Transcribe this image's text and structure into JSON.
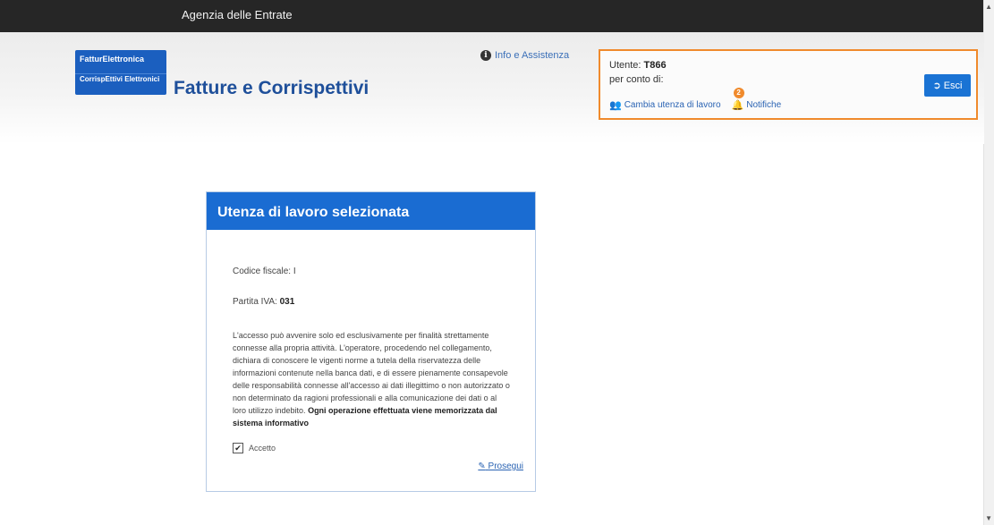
{
  "topbar": {
    "title": "Agenzia delle Entrate"
  },
  "logo": {
    "line1": "FatturElettronica",
    "line2": "CorrispEttivi Elettronici"
  },
  "app": {
    "title": "Fatture e Corrispettivi"
  },
  "info": {
    "label": "Info e Assistenza",
    "icon": "info-circle-icon"
  },
  "user_panel": {
    "user_prefix": "Utente:",
    "user_id": "T866",
    "on_behalf": "per conto di:",
    "change_label": "Cambia utenza di lavoro",
    "notifications_label": "Notifiche",
    "notifications_count": "2",
    "logout_label": "Esci",
    "border_color": "#f08a2c",
    "button_color": "#1a73d4"
  },
  "card": {
    "title": "Utenza di lavoro selezionata",
    "cf_label": "Codice fiscale:",
    "cf_value": "I",
    "piva_label": "Partita IVA:",
    "piva_value": "031",
    "legal_text": "L'accesso può avvenire solo ed esclusivamente per finalità strettamente connesse alla propria attività. L'operatore, procedendo nel collegamento, dichiara di conoscere le vigenti norme a tutela della riservatezza delle informazioni contenute nella banca dati, e di essere pienamente consapevole delle responsabilità connesse all'accesso ai dati illegittimo o non autorizzato o non determinato da ragioni professionali e alla comunicazione dei dati o al loro utilizzo indebito.",
    "legal_bold": "Ogni operazione effettuata viene memorizzata dal sistema informativo",
    "accept_label": "Accetto",
    "accept_checked": true,
    "proceed_label": "Prosegui",
    "header_color": "#1a6cd2"
  }
}
